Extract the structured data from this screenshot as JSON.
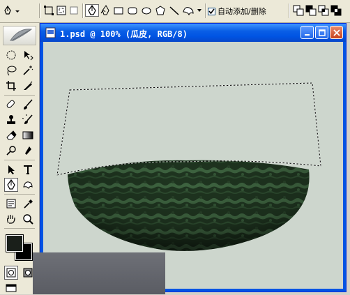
{
  "options_bar": {
    "auto_add_delete_label": "自动添加/删除",
    "auto_add_delete_checked": true,
    "icons": [
      "pen-tool-menu-icon",
      "shape-layers-icon",
      "paths-icon",
      "fill-pixels-icon",
      "pen-icon",
      "freeform-pen-icon",
      "rectangle-icon",
      "rounded-rectangle-icon",
      "ellipse-icon",
      "polygon-icon",
      "line-icon",
      "custom-shape-icon",
      "dropdown-arrow-icon",
      "combine-icon",
      "subtract-icon",
      "intersect-icon",
      "exclude-icon"
    ]
  },
  "toolbox": {
    "tools": [
      "marquee",
      "move",
      "lasso",
      "magic-wand",
      "crop",
      "slice",
      "healing-brush",
      "brush",
      "clone-stamp",
      "history-brush",
      "eraser",
      "gradient",
      "dodge",
      "sharpen",
      "path-selection",
      "type",
      "pen",
      "custom-shape",
      "notes",
      "eyedropper",
      "hand",
      "zoom"
    ],
    "active_tool": "pen",
    "foreground_color": "#1a1f1a",
    "background_color": "#000000"
  },
  "document": {
    "title": "1.psd @ 100% (瓜皮, RGB/8)",
    "canvas_color": "#cdd6cd",
    "watermelon_dark": "#1f3520",
    "watermelon_light": "#3e6440"
  }
}
